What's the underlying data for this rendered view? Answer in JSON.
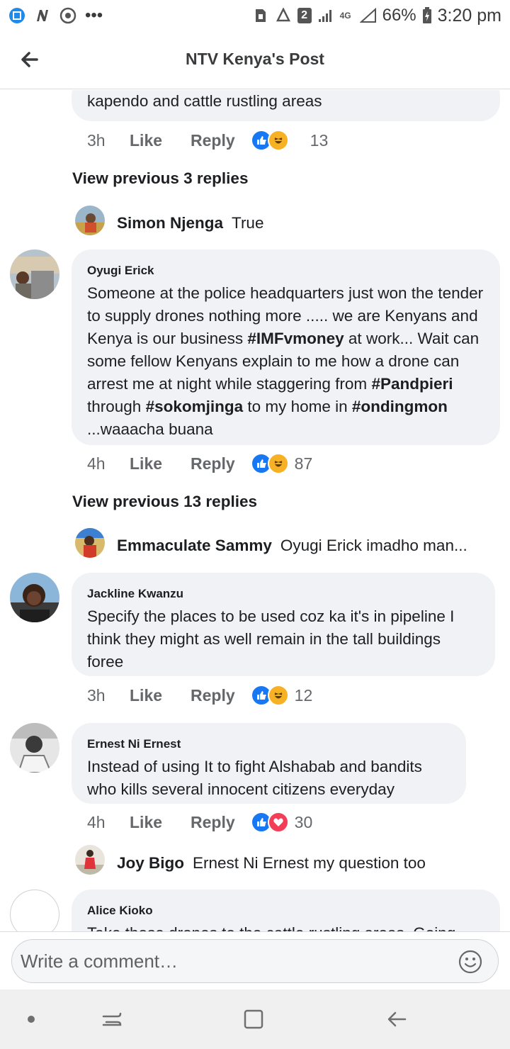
{
  "status_bar": {
    "left_icons": [
      "screenshot-icon",
      "n-app-icon",
      "chrome-icon",
      "more-notifications-icon"
    ],
    "more_text": "•••",
    "sim_badge": "2",
    "network": "4G",
    "battery_percent": "66%",
    "time": "3:20 pm"
  },
  "header": {
    "back_icon": "arrow-left-icon",
    "title": "NTV Kenya's Post"
  },
  "comments": [
    {
      "text": "kapendo and cattle rustling areas",
      "time": "3h",
      "like_label": "Like",
      "reply_label": "Reply",
      "reactions": [
        "like",
        "haha"
      ],
      "reaction_count": "13",
      "view_previous": "View previous 3 replies",
      "reply_preview": {
        "name": "Simon Njenga",
        "text": "True"
      }
    },
    {
      "author": "Oyugi Erick",
      "text_parts": [
        {
          "t": "Someone at the police headquarters just won the tender to supply drones nothing more ..... we are Kenyans and Kenya is our business ",
          "b": false
        },
        {
          "t": "#IMFvmoney",
          "b": true
        },
        {
          "t": " at work... Wait can some  fellow Kenyans explain to me how a drone can arrest me at night while staggering from ",
          "b": false
        },
        {
          "t": "#Pandpieri",
          "b": true
        },
        {
          "t": " through ",
          "b": false
        },
        {
          "t": "#sokomjinga",
          "b": true
        },
        {
          "t": " to my home in ",
          "b": false
        },
        {
          "t": "#ondingmon",
          "b": true
        },
        {
          "t": " ...waaacha buana",
          "b": false
        }
      ],
      "time": "4h",
      "like_label": "Like",
      "reply_label": "Reply",
      "reactions": [
        "like",
        "haha"
      ],
      "reaction_count": "87",
      "view_previous": "View previous 13 replies",
      "reply_preview": {
        "name": "Emmaculate Sammy",
        "text": "Oyugi Erick imadho man..."
      }
    },
    {
      "author": "Jackline Kwanzu",
      "text": "Specify the places to be used coz ka it's in pipeline I think they might as well remain in the tall buildings foree",
      "time": "3h",
      "like_label": "Like",
      "reply_label": "Reply",
      "reactions": [
        "like",
        "haha"
      ],
      "reaction_count": "12"
    },
    {
      "author": "Ernest Ni Ernest",
      "text": "Instead of using It to fight Alshabab and bandits who kills several innocent citizens  everyday",
      "time": "4h",
      "like_label": "Like",
      "reply_label": "Reply",
      "reactions": [
        "like",
        "love"
      ],
      "reaction_count": "30",
      "reply_preview": {
        "name": "Joy Bigo",
        "text": "Ernest Ni Ernest my question too"
      }
    },
    {
      "author": "Alice Kioko",
      "text": "Take those drones to the cattle rustling areas. Going"
    }
  ],
  "composer": {
    "placeholder": "Write a comment…",
    "emoji_icon": "smiley-icon"
  },
  "nav_bar": {
    "items": [
      "dot-icon",
      "recents-icon",
      "home-square-icon",
      "back-arrow-icon"
    ]
  },
  "colors": {
    "bubble": "#f0f2f5",
    "like_blue": "#1877f2",
    "haha_yellow": "#f7b125",
    "love_red": "#f33e58",
    "meta_gray": "#65676b"
  }
}
